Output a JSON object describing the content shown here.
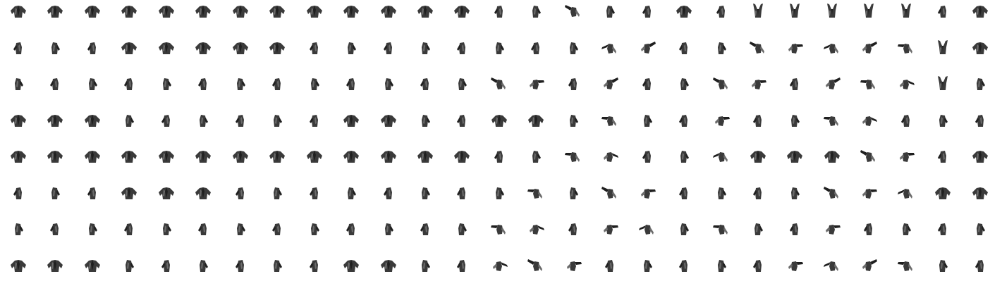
{
  "sheet": {
    "description_visible_text": "",
    "rows": 8,
    "columns": 27,
    "background": "#ffffff",
    "sprite_colors": {
      "body": "#3a3a3a",
      "shade": "#1f1f1f",
      "highlight": "#6b6b6b"
    },
    "row_poses": [
      [
        "front",
        "front",
        "front",
        "front",
        "front",
        "front",
        "front",
        "front",
        "front",
        "front",
        "front",
        "front",
        "front",
        "side",
        "side",
        "flail",
        "side",
        "side",
        "front",
        "side",
        "arms-up",
        "arms-up",
        "arms-up",
        "arms-up",
        "arms-up",
        "side",
        "front"
      ],
      [
        "side",
        "side",
        "side",
        "front",
        "front",
        "front",
        "front",
        "front",
        "side",
        "side",
        "side",
        "side",
        "side",
        "side",
        "side",
        "side",
        "flail",
        "flail",
        "side",
        "side",
        "flail",
        "flail",
        "flail",
        "flail",
        "flail",
        "arms-up",
        "front"
      ],
      [
        "side",
        "side",
        "side",
        "side",
        "side",
        "side",
        "side",
        "side",
        "side",
        "side",
        "side",
        "side",
        "side",
        "flail",
        "flail",
        "side",
        "flail",
        "side",
        "side",
        "flail",
        "flail",
        "side",
        "flail",
        "flail",
        "flail",
        "arms-up",
        "side"
      ],
      [
        "front",
        "front",
        "front",
        "side",
        "side",
        "side",
        "side",
        "side",
        "side",
        "front",
        "front",
        "side",
        "side",
        "front",
        "front",
        "side",
        "flail",
        "side",
        "side",
        "flail",
        "side",
        "side",
        "flail",
        "flail",
        "side",
        "side",
        "side"
      ],
      [
        "front",
        "front",
        "front",
        "front",
        "front",
        "front",
        "front",
        "front",
        "front",
        "front",
        "front",
        "front",
        "front",
        "side",
        "side",
        "flail",
        "flail",
        "side",
        "side",
        "flail",
        "front",
        "front",
        "front",
        "flail",
        "flail",
        "side",
        "front"
      ],
      [
        "side",
        "side",
        "side",
        "front",
        "front",
        "front",
        "side",
        "side",
        "side",
        "side",
        "side",
        "side",
        "side",
        "side",
        "flail",
        "side",
        "flail",
        "flail",
        "side",
        "side",
        "side",
        "side",
        "flail",
        "flail",
        "flail",
        "front",
        "front"
      ],
      [
        "side",
        "side",
        "side",
        "side",
        "side",
        "side",
        "side",
        "side",
        "side",
        "side",
        "side",
        "side",
        "side",
        "flail",
        "flail",
        "side",
        "flail",
        "flail",
        "side",
        "flail",
        "side",
        "side",
        "flail",
        "side",
        "side",
        "side",
        "side"
      ],
      [
        "front",
        "front",
        "front",
        "side",
        "side",
        "side",
        "side",
        "side",
        "side",
        "front",
        "front",
        "side",
        "side",
        "flail",
        "flail",
        "flail",
        "side",
        "side",
        "side",
        "side",
        "side",
        "flail",
        "flail",
        "flail",
        "flail",
        "side",
        "side"
      ]
    ]
  }
}
